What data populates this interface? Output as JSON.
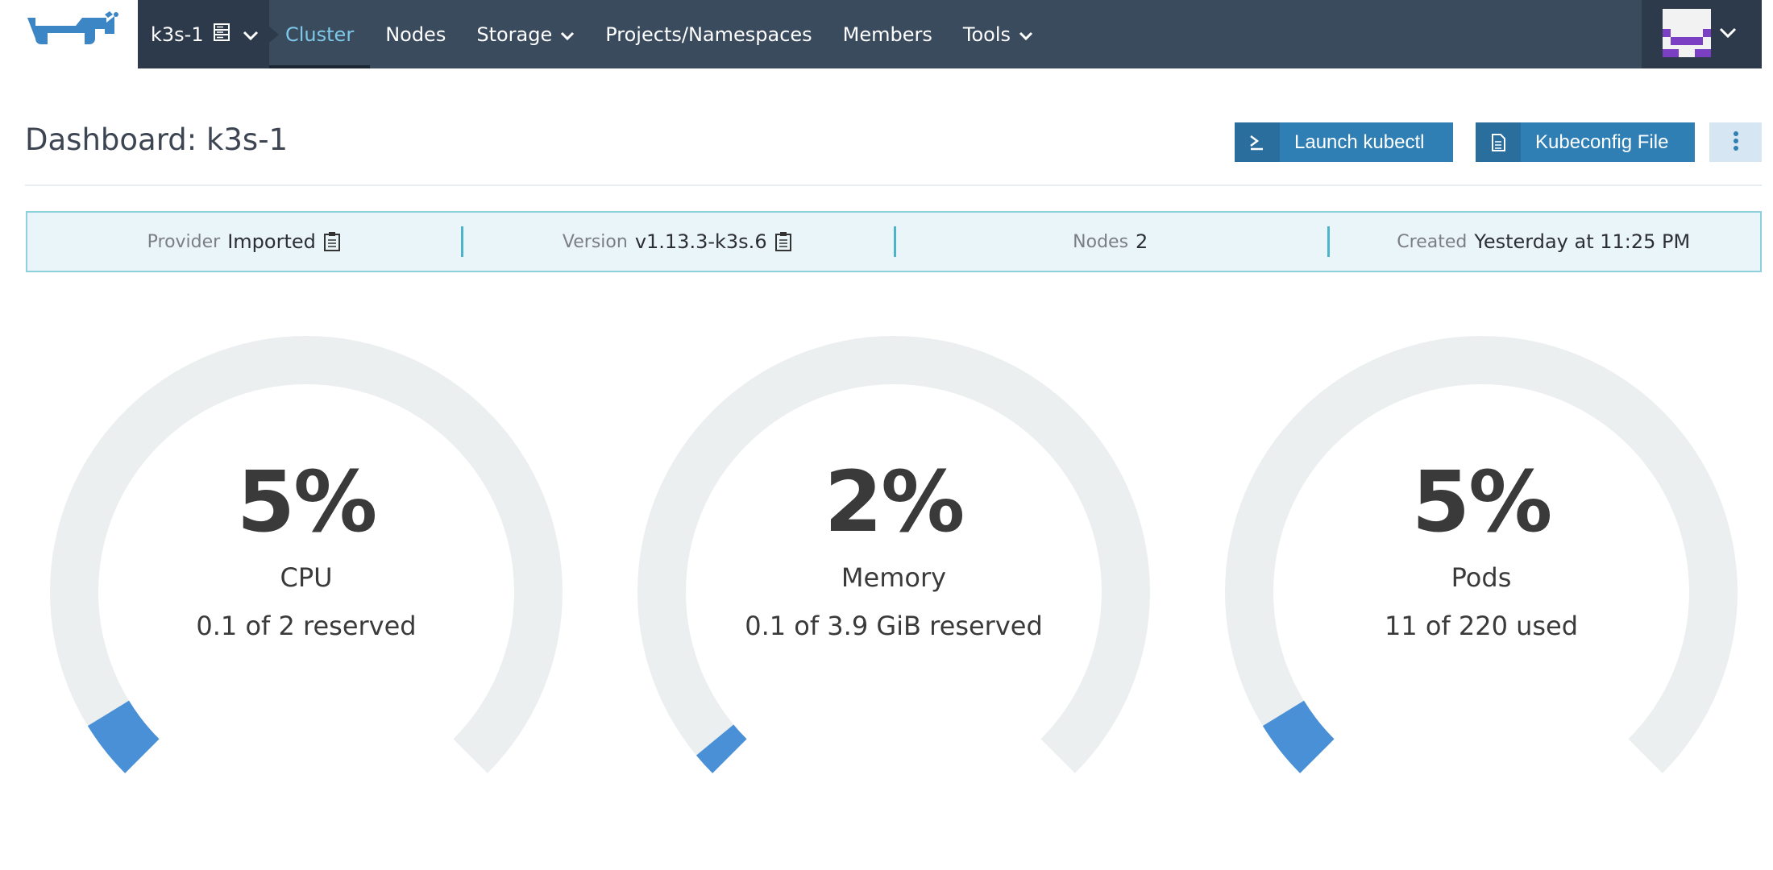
{
  "nav": {
    "cluster_name": "k3s-1",
    "items": [
      {
        "label": "Cluster",
        "active": true,
        "dropdown": false
      },
      {
        "label": "Nodes",
        "active": false,
        "dropdown": false
      },
      {
        "label": "Storage",
        "active": false,
        "dropdown": true
      },
      {
        "label": "Projects/Namespaces",
        "active": false,
        "dropdown": false
      },
      {
        "label": "Members",
        "active": false,
        "dropdown": false
      },
      {
        "label": "Tools",
        "active": false,
        "dropdown": true
      }
    ]
  },
  "header": {
    "title": "Dashboard: k3s-1",
    "kubectl_label": "Launch kubectl",
    "kubeconfig_label": "Kubeconfig File"
  },
  "info": {
    "provider_label": "Provider",
    "provider_value": "Imported",
    "version_label": "Version",
    "version_value": "v1.13.3-k3s.6",
    "nodes_label": "Nodes",
    "nodes_value": "2",
    "created_label": "Created",
    "created_value": "Yesterday at 11:25 PM"
  },
  "gauges": {
    "cpu": {
      "percent": "5%",
      "label": "CPU",
      "detail": "0.1 of 2 reserved",
      "fraction": 0.05
    },
    "memory": {
      "percent": "2%",
      "label": "Memory",
      "detail": "0.1 of 3.9 GiB reserved",
      "fraction": 0.02
    },
    "pods": {
      "percent": "5%",
      "label": "Pods",
      "detail": "11 of 220 used",
      "fraction": 0.05
    }
  },
  "colors": {
    "nav_bg": "#3b4b5e",
    "accent": "#2f7fb5",
    "gauge_fill": "#4a90d6",
    "gauge_track": "#ebeff0"
  }
}
